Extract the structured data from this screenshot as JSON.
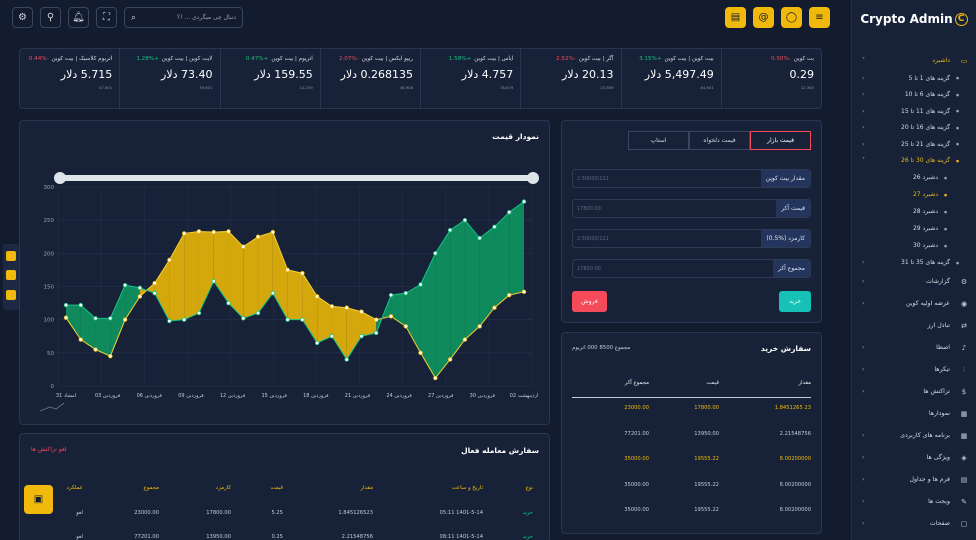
{
  "brand": {
    "title": "Crypto Admin",
    "coin_letter": "C"
  },
  "topbar": {
    "search_placeholder": "دنبال چی میگردی ... !؟"
  },
  "colors": {
    "accent": "#f0b90b",
    "up": "#19c37d",
    "down": "#f44a5a",
    "buy": "#16c1b5",
    "sell": "#f44a5a"
  },
  "sidebar": {
    "items": [
      {
        "label": "داشبرد",
        "icon": "monitor-icon",
        "level": 0,
        "active": true,
        "chev": "˅"
      },
      {
        "label": "گزینه های 1 تا 5",
        "level": 1,
        "chev": "‹"
      },
      {
        "label": "گزینه های 6 تا 10",
        "level": 1,
        "chev": "‹"
      },
      {
        "label": "گزینه های 11 تا 15",
        "level": 1,
        "chev": "‹"
      },
      {
        "label": "گزینه های 16 تا 20",
        "level": 1,
        "chev": "‹"
      },
      {
        "label": "گزینه های 21 تا 25",
        "level": 1,
        "chev": "‹"
      },
      {
        "label": "گزینه های 30 تا 26",
        "level": 1,
        "active": true,
        "chev": "˅"
      },
      {
        "label": "دشبرد 26",
        "level": 2
      },
      {
        "label": "دشبرد 27",
        "level": 2,
        "active": true
      },
      {
        "label": "دشبرد 28",
        "level": 2
      },
      {
        "label": "دشبرد 29",
        "level": 2
      },
      {
        "label": "دشبرد 30",
        "level": 2
      },
      {
        "label": "گزینه های 35 تا 31",
        "level": 1,
        "chev": "‹"
      },
      {
        "label": "گزارشات",
        "icon": "sliders-icon",
        "level": 0,
        "chev": "‹"
      },
      {
        "label": "عرضه اولیه کوین",
        "icon": "coin-icon",
        "level": 0,
        "chev": "‹"
      },
      {
        "label": "تبادل ارز",
        "icon": "exchange-icon",
        "level": 0
      },
      {
        "label": "اصطا",
        "icon": "bell-icon",
        "level": 0,
        "chev": "‹"
      },
      {
        "label": "تیکرها",
        "icon": "tune-icon",
        "level": 0,
        "chev": "‹"
      },
      {
        "label": "تراکنش ها",
        "icon": "dollar-icon",
        "level": 0,
        "chev": "‹"
      },
      {
        "label": "نمودارها",
        "icon": "chart-icon",
        "level": 0
      },
      {
        "label": "برنامه های کاربردی",
        "icon": "grid-icon",
        "level": 0,
        "chev": "‹"
      },
      {
        "label": "ویژگی ها",
        "icon": "cube-icon",
        "level": 0,
        "chev": "‹"
      },
      {
        "label": "فرم ها و جداول",
        "icon": "form-icon",
        "level": 0,
        "chev": "‹"
      },
      {
        "label": "ویجت ها",
        "icon": "widget-icon",
        "level": 0,
        "chev": "‹"
      },
      {
        "label": "صفحات",
        "icon": "pages-icon",
        "level": 0,
        "chev": "‹"
      }
    ]
  },
  "tickers": [
    {
      "name": "بت کوین",
      "change": "-0.50%",
      "dir": "dn",
      "price": "0.29",
      "vol": "12,365"
    },
    {
      "name": "بیت کوین | بیت کوین",
      "change": "+3.15%",
      "dir": "up",
      "price": "5,497.49 دلار",
      "vol": "84,601"
    },
    {
      "name": "آگر | بیت کوین",
      "change": "-2.52%",
      "dir": "dn",
      "price": "20.13 دلار",
      "vol": "23,569"
    },
    {
      "name": "ایاس | بیت کوین",
      "change": "+1.58%",
      "dir": "up",
      "price": "4.757 دلار",
      "vol": "78,879"
    },
    {
      "name": "ریپو ایکس | بیت کوین",
      "change": "-2.07%",
      "dir": "dn",
      "price": "0.268135 دلار",
      "vol": "46,908"
    },
    {
      "name": "اتریوم | بیت کوین",
      "change": "+0.47%",
      "dir": "up",
      "price": "159.55 دلار",
      "vol": "12,239"
    },
    {
      "name": "لایت کوین | بیت کوین",
      "change": "+1.28%",
      "dir": "up",
      "price": "73.40 دلار",
      "vol": "39,601"
    },
    {
      "name": "اتریوم کلاسیک | بیت کوین",
      "change": "-0.44%",
      "dir": "dn",
      "price": "5.715 دلار",
      "vol": "47,601"
    }
  ],
  "chart_data": {
    "type": "area",
    "title": "نمودار قیمت",
    "categories": [
      "امشاد 31",
      "فروردین 03",
      "فروردین 06",
      "فروردین 09",
      "فروردین 12",
      "فروردین 15",
      "فروردین 18",
      "فروردین 21",
      "فروردین 24",
      "فروردین 27",
      "فروردین 30",
      "اردیبهشت 02"
    ],
    "ylim": [
      0,
      300
    ],
    "yticks": [
      0,
      50,
      100,
      150,
      200,
      250,
      300
    ],
    "series": [
      {
        "name": "",
        "values": [
          103,
          70,
          55,
          45,
          100,
          135,
          155,
          190,
          230,
          233,
          232,
          233,
          210,
          225,
          232,
          175,
          170,
          135,
          120,
          118,
          112,
          100,
          105,
          90,
          50,
          12,
          40,
          70,
          90,
          118,
          137,
          142,
          130
        ]
      },
      {
        "name": "",
        "values": [
          122,
          122,
          102,
          102,
          152,
          148,
          140,
          98,
          100,
          110,
          158,
          125,
          102,
          110,
          140,
          100,
          100,
          65,
          75,
          40,
          75,
          80,
          137,
          140,
          153,
          200,
          235,
          250,
          223,
          240,
          262,
          278
        ]
      }
    ]
  },
  "trade": {
    "tabs": [
      "قیمت بازار",
      "قیمت دلخواه",
      "استاپ"
    ],
    "fields": [
      {
        "label": "مقدار بیت کوین",
        "value": "2.50000/121"
      },
      {
        "label": "قیمت آکر",
        "value": "17800.00"
      },
      {
        "label": "کارمزد (%0.5)",
        "value": "2.50000/121"
      },
      {
        "label": "مجموع آکر",
        "value": "17800.00"
      }
    ],
    "buy": "خرید",
    "sell": "فروش"
  },
  "orders": {
    "title": "سفارش خرید",
    "total": "مجموع 8500 000 اتریوم",
    "headers": [
      "مقدار",
      "قیمت",
      "مجموع آکر"
    ],
    "rows": [
      {
        "cells": [
          "1.8451265 23",
          "17800.00",
          "23000.00"
        ],
        "hl": true
      },
      {
        "cells": [
          "2.21548756",
          "13950.00",
          "77201.00"
        ],
        "hl": false
      },
      {
        "cells": [
          "8.00200000",
          "19555.22",
          "35000.00"
        ],
        "hl": true
      },
      {
        "cells": [
          "8.00200000",
          "19555.22",
          "35000.00"
        ],
        "hl": false
      },
      {
        "cells": [
          "8.00200000",
          "19555.22",
          "35000.00"
        ],
        "hl": false
      }
    ]
  },
  "open": {
    "title": "سفارش معامله فعال",
    "cancel": "لغو تراکنش ها",
    "headers": [
      "نوع",
      "تاریخ و ساعت",
      "مقدار",
      "قیمت",
      "کارمزد",
      "مجموع",
      "عملکرد"
    ],
    "rows": [
      {
        "cells": [
          "خرید",
          "05:11 1401-5-14",
          "1.845126523",
          "5.25",
          "17800.00",
          "23000.00",
          "لغو"
        ]
      },
      {
        "cells": [
          "خرید",
          "08:11 1401-5-14",
          "2.21548756",
          "0.25",
          "13950.00",
          "77201.00",
          "لغو"
        ]
      }
    ]
  }
}
